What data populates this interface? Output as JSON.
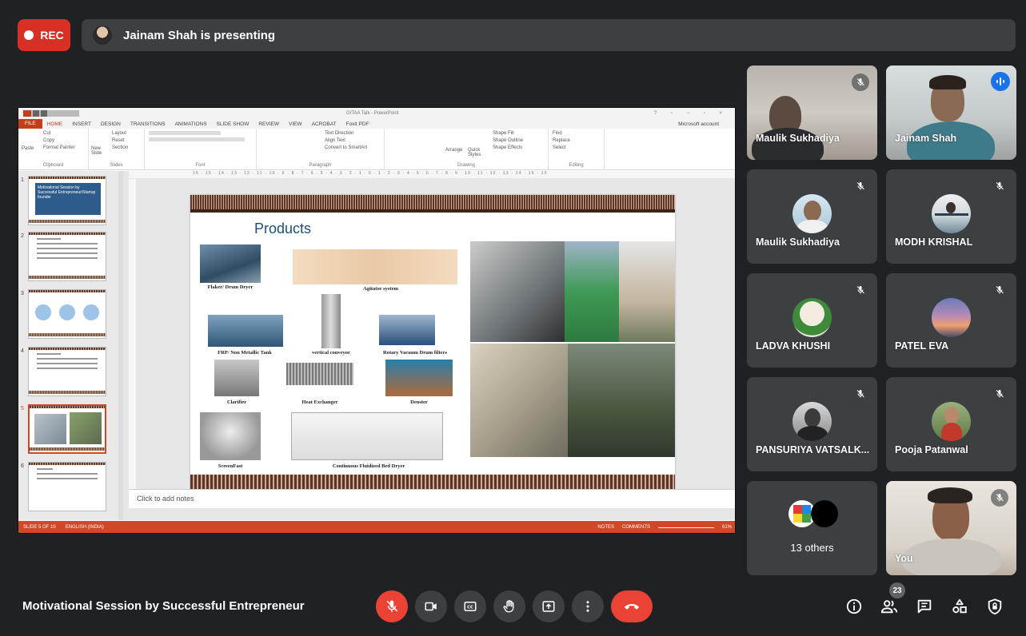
{
  "recording": {
    "label": "REC"
  },
  "presenter": {
    "text": "Jainam Shah is presenting"
  },
  "ppt": {
    "window_title": "GITAA Talk - PowerPoint",
    "tabs": [
      "FILE",
      "HOME",
      "INSERT",
      "DESIGN",
      "TRANSITIONS",
      "ANIMATIONS",
      "SLIDE SHOW",
      "REVIEW",
      "VIEW",
      "ACROBAT",
      "Foxit PDF"
    ],
    "account": "Microsoft account",
    "ribbon_groups": [
      "Clipboard",
      "Slides",
      "Font",
      "Paragraph",
      "Drawing",
      "Editing"
    ],
    "ribbon": {
      "cut": "Cut",
      "copy": "Copy",
      "format_painter": "Format Painter",
      "paste": "Paste",
      "new_slide": "New Slide",
      "layout": "Layout",
      "reset": "Reset",
      "section": "Section",
      "text_direction": "Text Direction",
      "align_text": "Align Text",
      "smartart": "Convert to SmartArt",
      "arrange": "Arrange",
      "quick_styles": "Quick Styles",
      "shape_fill": "Shape Fill",
      "shape_outline": "Shape Outline",
      "shape_effects": "Shape Effects",
      "find": "Find",
      "replace": "Replace",
      "select": "Select"
    },
    "ruler": "16 · 15 · 14 · 13 · 12 · 11 · 10 · 9 · 8 · 7 · 6 · 5 · 4 · 3 · 2 · 1 · 0 · 1 · 2 · 3 · 4 · 5 · 6 · 7 · 8 · 9 · 10 · 11 · 12 · 13 · 14 · 15 · 16",
    "thumbnails": [
      "1",
      "2",
      "3",
      "4",
      "5",
      "6"
    ],
    "thumb1_title": "Motivational Session by Successful Entrepreneur/Startup founder",
    "slide": {
      "title": "Products",
      "captions": {
        "flaker": "Flaker/ Drum Dryer",
        "agitator": "Agitator system",
        "frp": "FRP/ Non Metallic Tank",
        "conveyor": "vertical conveyor",
        "rotary": "Rotary Vacuum Drum filters",
        "clarifier": "Clarifier",
        "heat": "Heat Exchanger",
        "denster": "Denster",
        "screen": "ScreenFast",
        "fluidized": "Continuous Fluidized Bed Dryer"
      }
    },
    "notes_placeholder": "Click to add notes",
    "status": {
      "slide": "SLIDE 5 OF 10",
      "language": "ENGLISH (INDIA)",
      "notes": "NOTES",
      "comments": "COMMENTS",
      "zoom": "61%"
    }
  },
  "participants": [
    {
      "name": "Maulik Sukhadiya",
      "state": "muted"
    },
    {
      "name": "Jainam Shah",
      "state": "speaking"
    },
    {
      "name": "Maulik Sukhadiya",
      "state": "muted"
    },
    {
      "name": "MODH KRISHAL",
      "state": "muted"
    },
    {
      "name": "LADVA KHUSHI",
      "state": "muted"
    },
    {
      "name": "PATEL EVA",
      "state": "muted"
    },
    {
      "name": "PANSURIYA VATSALK...",
      "state": "muted"
    },
    {
      "name": "Pooja Patanwal",
      "state": "muted"
    },
    {
      "name": "13 others",
      "state": "group"
    },
    {
      "name": "You",
      "state": "muted"
    }
  ],
  "meeting": {
    "title": "Motivational Session by Successful Entrepreneur"
  },
  "controls": {
    "mic": "mic-off-icon",
    "camera": "camera-icon",
    "captions": "captions-icon",
    "raise_hand": "hand-icon",
    "present": "present-icon",
    "more": "more-icon",
    "end_call": "end-call-icon"
  },
  "right_controls": {
    "participant_count": "23"
  },
  "colors": {
    "background": "#202124",
    "tile": "#3c4043",
    "rec": "#d93025",
    "end_call": "#ea4335",
    "active_speaker": "#8ab4f8",
    "ppt_accent": "#d24726"
  }
}
